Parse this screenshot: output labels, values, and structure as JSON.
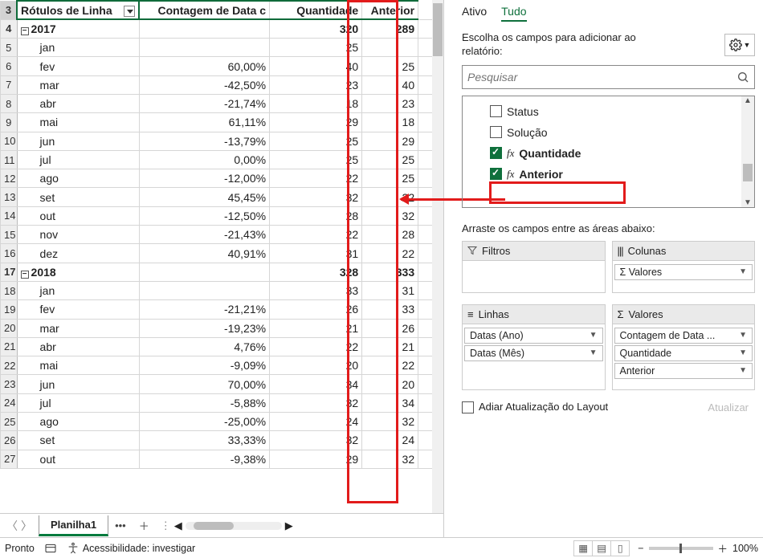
{
  "grid": {
    "header": {
      "a": "Rótulos de Linha",
      "b": "Contagem de Data c",
      "c": "Quantidade",
      "d": "Anterior"
    },
    "rows": [
      {
        "n": 3,
        "type": "header"
      },
      {
        "n": 4,
        "type": "year",
        "a": "2017",
        "b": "",
        "c": "320",
        "d": "289"
      },
      {
        "n": 5,
        "type": "m",
        "a": "jan",
        "b": "",
        "c": "25",
        "d": ""
      },
      {
        "n": 6,
        "type": "m",
        "a": "fev",
        "b": "60,00%",
        "c": "40",
        "d": "25"
      },
      {
        "n": 7,
        "type": "m",
        "a": "mar",
        "b": "-42,50%",
        "c": "23",
        "d": "40"
      },
      {
        "n": 8,
        "type": "m",
        "a": "abr",
        "b": "-21,74%",
        "c": "18",
        "d": "23"
      },
      {
        "n": 9,
        "type": "m",
        "a": "mai",
        "b": "61,11%",
        "c": "29",
        "d": "18"
      },
      {
        "n": 10,
        "type": "m",
        "a": "jun",
        "b": "-13,79%",
        "c": "25",
        "d": "29"
      },
      {
        "n": 11,
        "type": "m",
        "a": "jul",
        "b": "0,00%",
        "c": "25",
        "d": "25"
      },
      {
        "n": 12,
        "type": "m",
        "a": "ago",
        "b": "-12,00%",
        "c": "22",
        "d": "25"
      },
      {
        "n": 13,
        "type": "m",
        "a": "set",
        "b": "45,45%",
        "c": "32",
        "d": "22"
      },
      {
        "n": 14,
        "type": "m",
        "a": "out",
        "b": "-12,50%",
        "c": "28",
        "d": "32"
      },
      {
        "n": 15,
        "type": "m",
        "a": "nov",
        "b": "-21,43%",
        "c": "22",
        "d": "28"
      },
      {
        "n": 16,
        "type": "m",
        "a": "dez",
        "b": "40,91%",
        "c": "31",
        "d": "22"
      },
      {
        "n": 17,
        "type": "year",
        "a": "2018",
        "b": "",
        "c": "328",
        "d": "333"
      },
      {
        "n": 18,
        "type": "m",
        "a": "jan",
        "b": "",
        "c": "33",
        "d": "31"
      },
      {
        "n": 19,
        "type": "m",
        "a": "fev",
        "b": "-21,21%",
        "c": "26",
        "d": "33"
      },
      {
        "n": 20,
        "type": "m",
        "a": "mar",
        "b": "-19,23%",
        "c": "21",
        "d": "26"
      },
      {
        "n": 21,
        "type": "m",
        "a": "abr",
        "b": "4,76%",
        "c": "22",
        "d": "21"
      },
      {
        "n": 22,
        "type": "m",
        "a": "mai",
        "b": "-9,09%",
        "c": "20",
        "d": "22"
      },
      {
        "n": 23,
        "type": "m",
        "a": "jun",
        "b": "70,00%",
        "c": "34",
        "d": "20"
      },
      {
        "n": 24,
        "type": "m",
        "a": "jul",
        "b": "-5,88%",
        "c": "32",
        "d": "34"
      },
      {
        "n": 25,
        "type": "m",
        "a": "ago",
        "b": "-25,00%",
        "c": "24",
        "d": "32"
      },
      {
        "n": 26,
        "type": "m",
        "a": "set",
        "b": "33,33%",
        "c": "32",
        "d": "24"
      },
      {
        "n": 27,
        "type": "m",
        "a": "out",
        "b": "-9,38%",
        "c": "29",
        "d": "32"
      }
    ]
  },
  "sheet_tab": "Planilha1",
  "panel": {
    "tab_active": "Ativo",
    "tab_all": "Tudo",
    "instruction": "Escolha os campos para adicionar ao relatório:",
    "search_placeholder": "Pesquisar",
    "fields": [
      {
        "label": "Status",
        "checked": false,
        "fx": false,
        "bold": false
      },
      {
        "label": "Solução",
        "checked": false,
        "fx": false,
        "bold": false
      },
      {
        "label": "Quantidade",
        "checked": true,
        "fx": true,
        "bold": true
      },
      {
        "label": "Anterior",
        "checked": true,
        "fx": true,
        "bold": true
      }
    ],
    "drag_label": "Arraste os campos entre as áreas abaixo:",
    "filters_label": "Filtros",
    "columns_label": "Colunas",
    "rows_label": "Linhas",
    "values_label": "Valores",
    "columns_items": [
      "Σ Valores"
    ],
    "rows_items": [
      "Datas (Ano)",
      "Datas (Mês)"
    ],
    "values_items": [
      "Contagem de Data ...",
      "Quantidade",
      "Anterior"
    ],
    "defer_label": "Adiar Atualização do Layout",
    "update_btn": "Atualizar"
  },
  "status": {
    "ready": "Pronto",
    "access": "Acessibilidade: investigar",
    "zoom": "100%"
  }
}
